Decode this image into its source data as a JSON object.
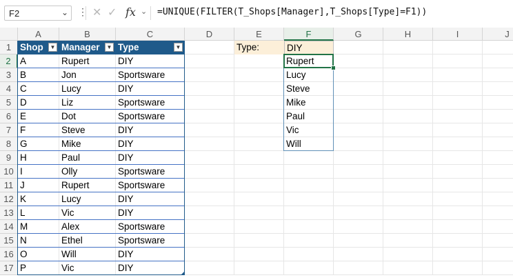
{
  "formula_bar": {
    "name_box": "F2",
    "formula": "=UNIQUE(FILTER(T_Shops[Manager],T_Shops[Type]=F1))",
    "fx_label": "fx"
  },
  "columns": [
    "A",
    "B",
    "C",
    "D",
    "E",
    "F",
    "G",
    "H",
    "I",
    "J"
  ],
  "rows": [
    "1",
    "2",
    "3",
    "4",
    "5",
    "6",
    "7",
    "8",
    "9",
    "10",
    "11",
    "12",
    "13",
    "14",
    "15",
    "16",
    "17"
  ],
  "table": {
    "name": "T_Shops",
    "headers": [
      "Shop",
      "Manager",
      "Type"
    ],
    "rows": [
      [
        "A",
        "Rupert",
        "DIY"
      ],
      [
        "B",
        "Jon",
        "Sportsware"
      ],
      [
        "C",
        "Lucy",
        "DIY"
      ],
      [
        "D",
        "Liz",
        "Sportsware"
      ],
      [
        "E",
        "Dot",
        "Sportsware"
      ],
      [
        "F",
        "Steve",
        "DIY"
      ],
      [
        "G",
        "Mike",
        "DIY"
      ],
      [
        "H",
        "Paul",
        "DIY"
      ],
      [
        "I",
        "Olly",
        "Sportsware"
      ],
      [
        "J",
        "Rupert",
        "Sportsware"
      ],
      [
        "K",
        "Lucy",
        "DIY"
      ],
      [
        "L",
        "Vic",
        "DIY"
      ],
      [
        "M",
        "Alex",
        "Sportsware"
      ],
      [
        "N",
        "Ethel",
        "Sportsware"
      ],
      [
        "O",
        "Will",
        "DIY"
      ],
      [
        "P",
        "Vic",
        "DIY"
      ]
    ]
  },
  "criteria": {
    "label": "Type:",
    "value": "DIY"
  },
  "spill_results": [
    "Rupert",
    "Lucy",
    "Steve",
    "Mike",
    "Paul",
    "Vic",
    "Will"
  ],
  "colors": {
    "table_header": "#1f5a8a",
    "criteria_fill": "#fcefd9",
    "selection": "#217346"
  }
}
